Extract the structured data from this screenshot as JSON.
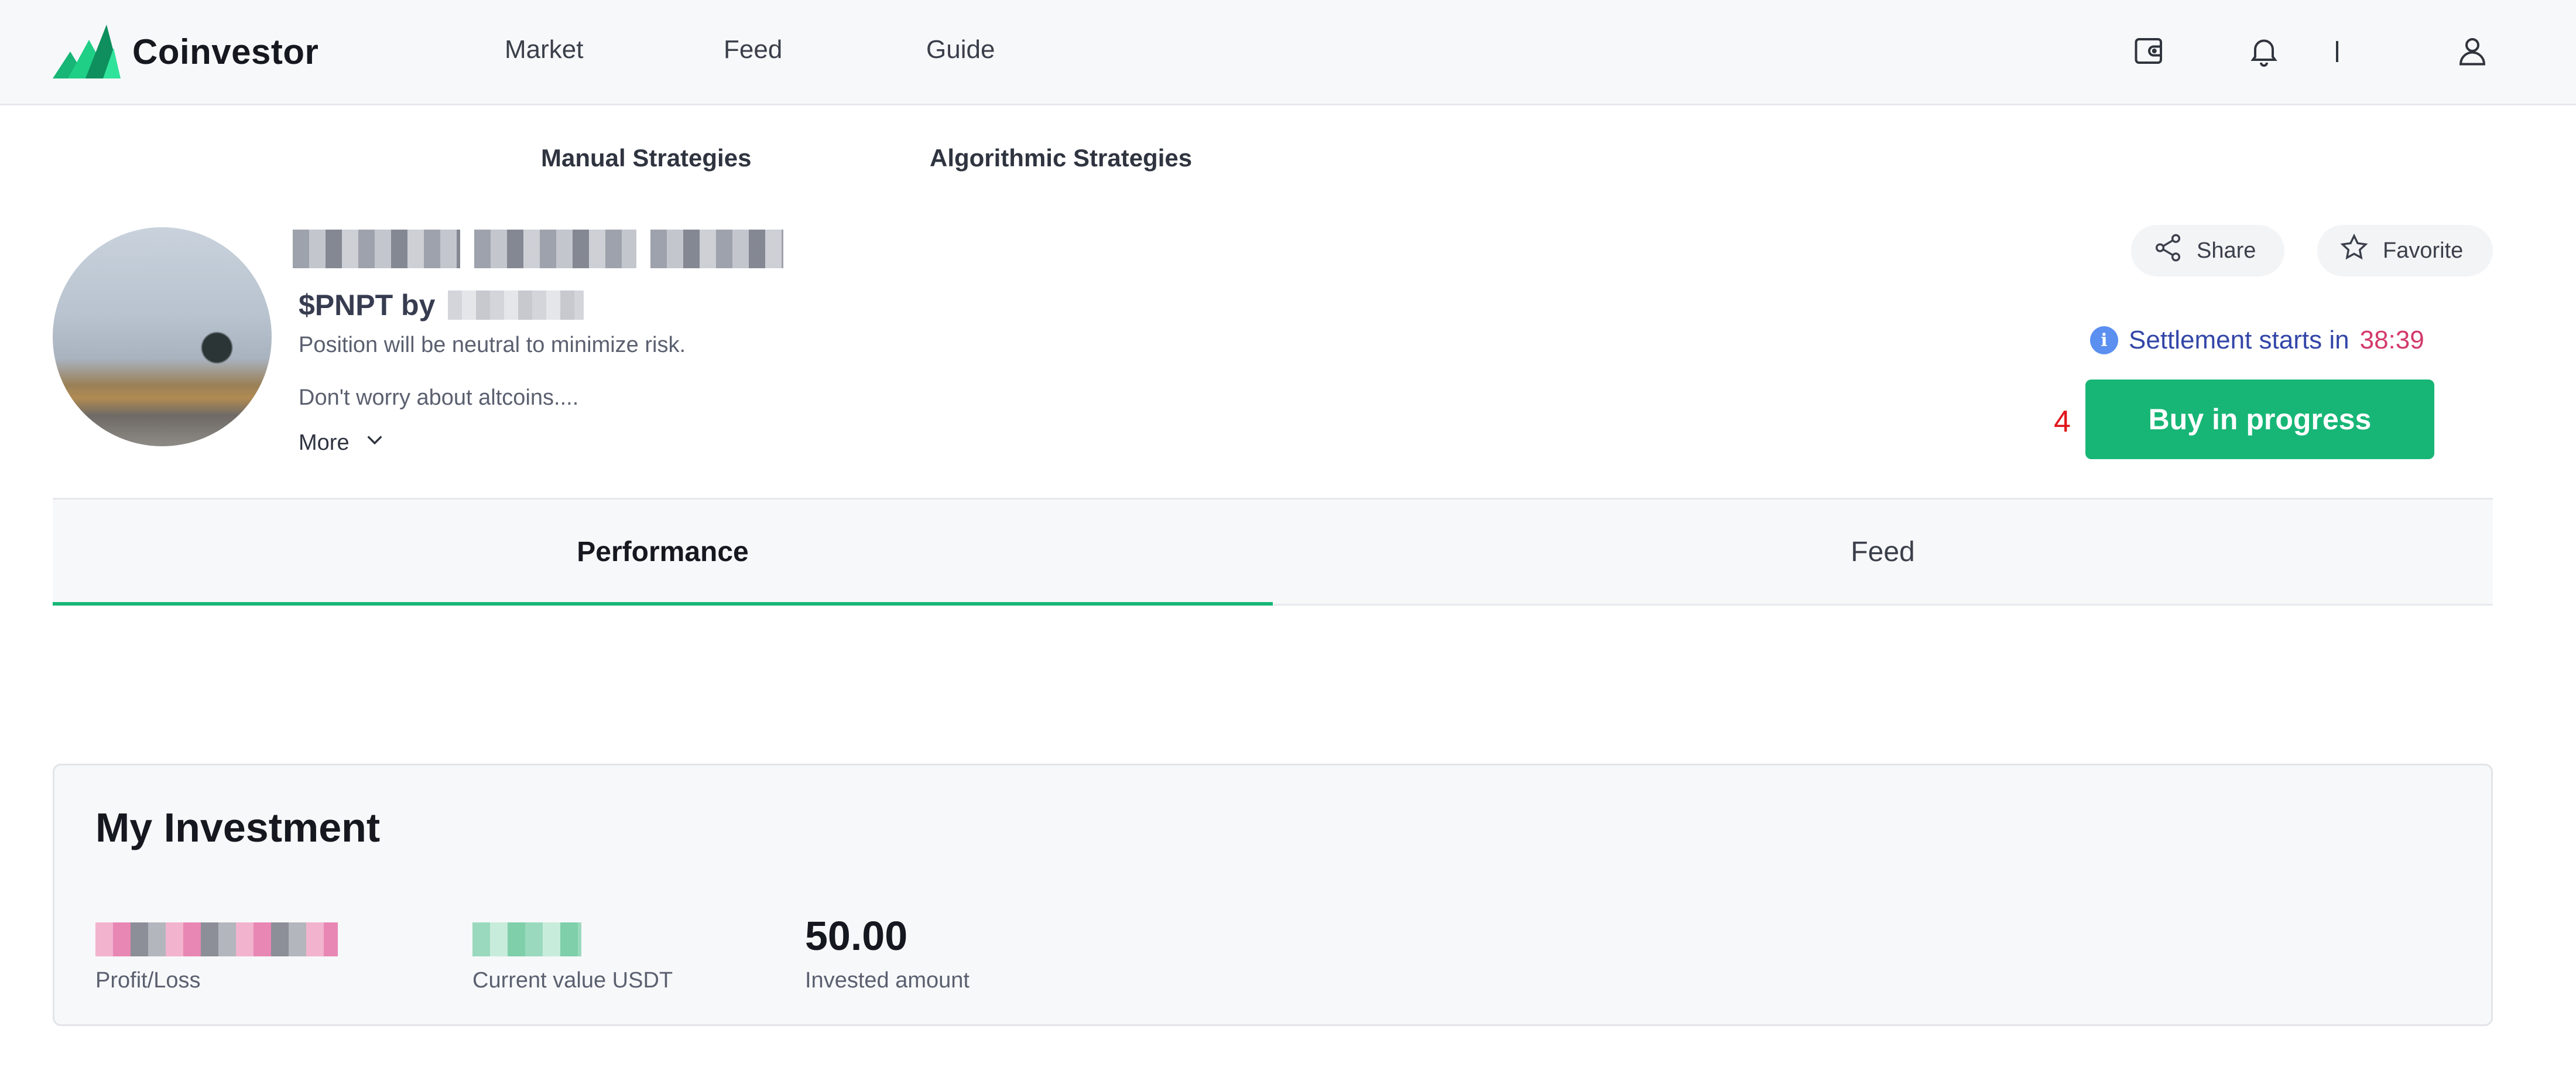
{
  "app": {
    "name": "Coinvestor"
  },
  "nav": {
    "links": [
      "Market",
      "Feed",
      "Guide"
    ],
    "separator": "|"
  },
  "strategy_tabs": [
    "Manual Strategies",
    "Algorithmic Strategies"
  ],
  "profile": {
    "ticker": "$PNPT by",
    "description_1": "Position will be neutral to minimize risk.",
    "description_2": "Don't worry about altcoins....",
    "more_label": "More"
  },
  "actions": {
    "share_label": "Share",
    "favorite_label": "Favorite",
    "settlement_text": "Settlement starts in",
    "settlement_countdown": "38:39",
    "step_marker": "4",
    "buy_label": "Buy in progress"
  },
  "content_tabs": [
    {
      "label": "Performance",
      "active": true
    },
    {
      "label": "Feed",
      "active": false
    }
  ],
  "investment": {
    "title": "My Investment",
    "profit_loss_label": "Profit/Loss",
    "current_value_label": "Current value USDT",
    "invested_amount": "50.00",
    "invested_amount_label": "Invested amount"
  },
  "colors": {
    "accent": "#17b676",
    "countdown": "#d33a6b",
    "step_marker": "#e0161b",
    "info": "#5b8ff0"
  },
  "icons": {
    "wallet": "wallet-icon",
    "bell": "bell-icon",
    "user": "user-icon",
    "share": "share-icon",
    "star": "star-icon",
    "chevron": "chevron-down-icon",
    "info": "info-icon"
  }
}
